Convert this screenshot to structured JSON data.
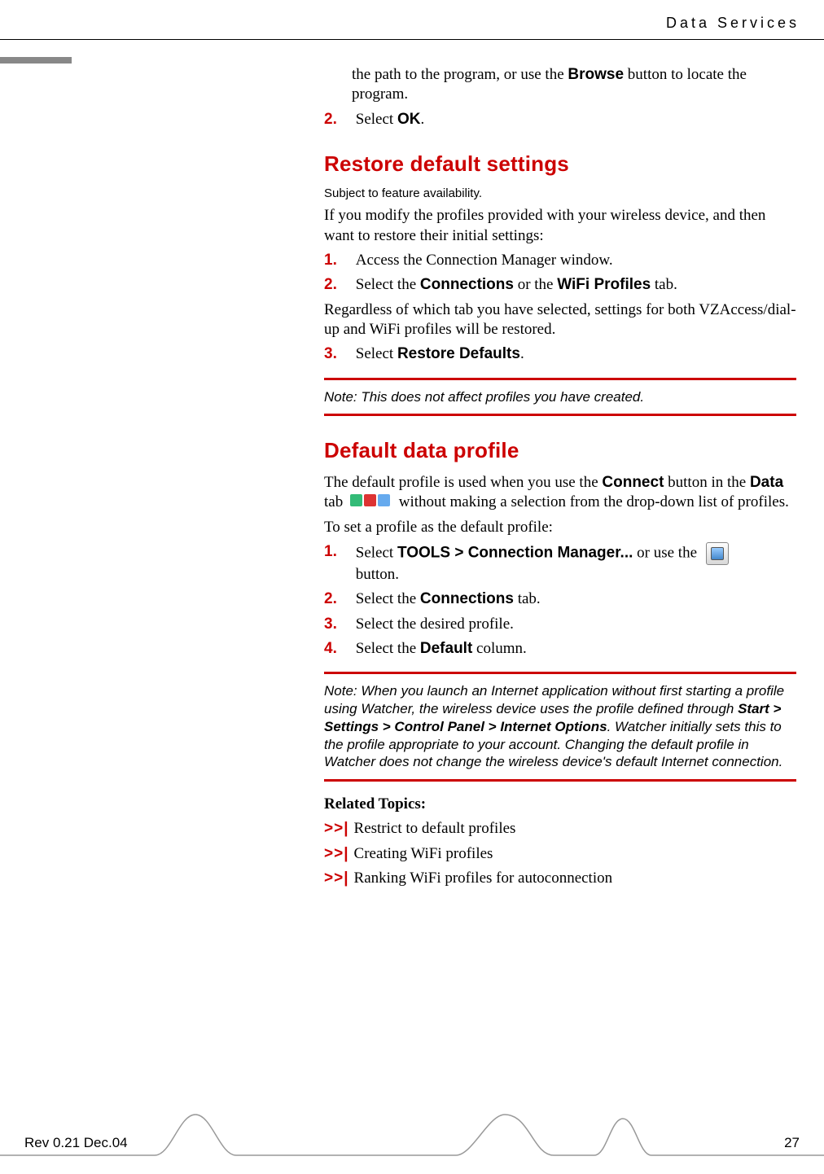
{
  "header": {
    "section": "Data Services"
  },
  "intro_continued": {
    "line": "the path to the program, or use the ",
    "bold": "Browse",
    "after": " button to locate the program."
  },
  "intro_step2": {
    "num": "2.",
    "pre": "Select ",
    "bold": "OK",
    "post": "."
  },
  "restore": {
    "heading": "Restore default settings",
    "sub": "Subject to feature availability.",
    "para": "If you modify the profiles provided with your wireless device, and then want to restore their initial settings:",
    "steps": [
      {
        "num": "1.",
        "text": "Access the Connection Manager window."
      },
      {
        "num": "2.",
        "pre": "Select the ",
        "b1": "Connections",
        "mid": " or the ",
        "b2": "WiFi Profiles",
        "post": " tab.",
        "sub": "Regardless of which tab you have selected, settings for both VZAccess/dial-up and WiFi profiles will be restored."
      },
      {
        "num": "3.",
        "pre": "Select ",
        "b1": "Restore Defaults",
        "post": "."
      }
    ],
    "note": "Note:  This does not affect profiles you have created."
  },
  "default_profile": {
    "heading": "Default data profile",
    "p1_pre": "The default profile is used when you use the ",
    "p1_b1": "Connect",
    "p1_mid1": " button in the ",
    "p1_b2": "Data",
    "p1_mid2": " tab ",
    "p1_post": " without making a selection from the drop-down list of profiles.",
    "p2": "To set a profile as the default profile:",
    "steps": [
      {
        "num": "1.",
        "pre": "Select ",
        "b1": "TOOLS > Connection Manager...",
        "post": " or use the ",
        "tail": " button."
      },
      {
        "num": "2.",
        "pre": "Select the ",
        "b1": "Connections",
        "post": " tab."
      },
      {
        "num": "3.",
        "text": "Select the desired profile."
      },
      {
        "num": "4.",
        "pre": "Select the ",
        "b1": "Default",
        "post": " column."
      }
    ],
    "note_pre": "Note:  When you launch an Internet application without first starting a profile using Watcher, the wireless device uses the profile defined through ",
    "note_bold": "Start > Settings > Control Panel > Internet Options",
    "note_post": ". Watcher initially sets this to the profile appropriate to your account. Changing the default profile in Watcher does not change the wireless device's default Internet connection."
  },
  "related": {
    "heading": "Related Topics:",
    "mark": ">>|",
    "items": [
      "Restrict to default profiles",
      "Creating WiFi profiles",
      "Ranking WiFi profiles for autoconnection"
    ]
  },
  "footer": {
    "left": "Rev 0.21  Dec.04",
    "right": "27"
  }
}
